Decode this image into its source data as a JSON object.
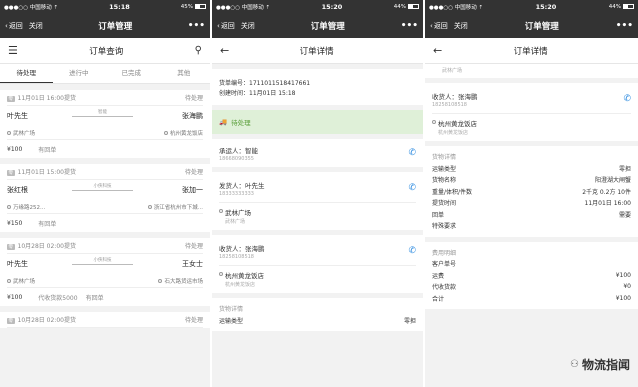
{
  "screens": [
    {
      "carrier": "●●●○○ 中国移动 ⇡",
      "time": "15:18",
      "battery": "45%",
      "battery_fill": 0.45
    },
    {
      "carrier": "●●●○○ 中国移动 ⇡",
      "time": "15:20",
      "battery": "44%",
      "battery_fill": 0.44
    },
    {
      "carrier": "●●●○○ 中国移动 ⇡",
      "time": "15:20",
      "battery": "44%",
      "battery_fill": 0.44
    }
  ],
  "nav": {
    "back": "返回",
    "close": "关闭",
    "title": "订单管理",
    "more": "•••"
  },
  "list": {
    "title": "订单查询",
    "tabs": [
      "待处理",
      "进行中",
      "已完成",
      "其他"
    ],
    "orders": [
      {
        "badge": "零",
        "time": "11月01日 16:00提货",
        "status": "待处理",
        "sender": "叶先生",
        "via": "智能",
        "receiver": "张海鹏",
        "from": "武林广场",
        "to": "杭州黄龙饭店",
        "price": "¥100",
        "receipt": "有回单",
        "extra": ""
      },
      {
        "badge": "零",
        "time": "11月01日 15:00提货",
        "status": "待处理",
        "sender": "张红根",
        "via": "小侠科技",
        "receiver": "张加一",
        "from": "万缘路252...",
        "to": "浙江省杭州市下城...",
        "price": "¥150",
        "receipt": "有回单",
        "extra": ""
      },
      {
        "badge": "零",
        "time": "10月28日 02:00提货",
        "status": "待处理",
        "sender": "叶先生",
        "via": "小侠科技",
        "receiver": "王女士",
        "from": "武林广场",
        "to": "石大路货运市场",
        "price": "¥100",
        "receipt": "有回单",
        "extra": "代收货款5000"
      },
      {
        "badge": "零",
        "time": "10月28日 02:00提货",
        "status": "待处理"
      }
    ]
  },
  "detail": {
    "title": "订单详情",
    "order_no_label": "货单编号：",
    "order_no": "1711011518417661",
    "created_label": "创建时间：",
    "created": "11月01日 15:18",
    "status": "待处理",
    "carrier_label": "承运人：",
    "carrier": "智能",
    "carrier_phone": "18668090355",
    "shipper_label": "发货人：",
    "shipper": "叶先生",
    "shipper_phone": "18333333333",
    "shipper_addr": "武林广场",
    "shipper_addr_sub": "武林广场",
    "consignee_label": "收货人：",
    "consignee": "张海鹏",
    "consignee_phone": "18258108518",
    "consignee_addr": "杭州黄龙饭店",
    "consignee_addr_sub": "杭州黄龙饭店",
    "goods_head": "货物详情",
    "transport_label": "运输类型",
    "transport": "零担"
  },
  "detail2": {
    "top_addr_sub": "武林广场",
    "consignee_label": "收货人：",
    "consignee": "张海鹏",
    "consignee_phone": "18258108518",
    "consignee_addr": "杭州黄龙饭店",
    "consignee_addr_sub": "杭州黄龙饭店",
    "goods_head": "货物详情",
    "goods": [
      {
        "k": "运输类型",
        "v": "零担"
      },
      {
        "k": "货物名称",
        "v": "阳澄湖大闸蟹"
      },
      {
        "k": "重量/体积/件数",
        "v": "2千克 0.2方 10件"
      },
      {
        "k": "提货时间",
        "v": "11月01日 16:00"
      },
      {
        "k": "回单",
        "v": "需要"
      },
      {
        "k": "特殊要求",
        "v": ""
      }
    ],
    "fee_head": "费用明细",
    "fees": [
      {
        "k": "客户单号",
        "v": ""
      },
      {
        "k": "运费",
        "v": "¥100"
      },
      {
        "k": "代收货款",
        "v": "¥0"
      },
      {
        "k": "合计",
        "v": "¥100"
      }
    ]
  },
  "watermark": "物流指闻"
}
